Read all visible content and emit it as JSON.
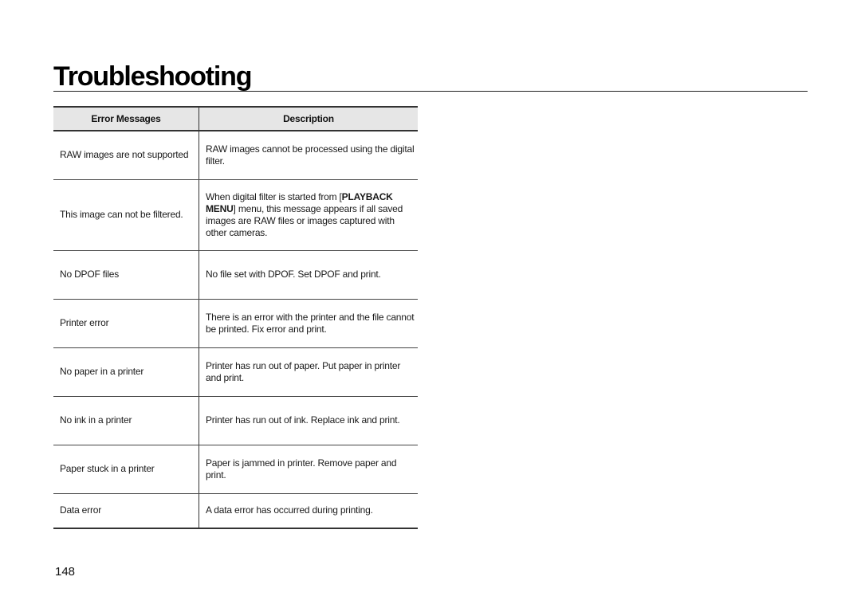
{
  "page": {
    "title": "Troubleshooting",
    "page_number": "148"
  },
  "table": {
    "headers": [
      "Error Messages",
      "Description"
    ],
    "rows": [
      {
        "error": "RAW images are not supported",
        "description": [
          "RAW images cannot be processed using the digital filter."
        ]
      },
      {
        "error": "This image can not be filtered.",
        "description": [
          "When digital filter is started from [",
          "PLAYBACK MENU",
          "] menu, this message appears if all saved images are RAW files or images captured with other cameras."
        ]
      },
      {
        "error": "No DPOF files",
        "description": [
          "No file set with DPOF. Set DPOF and print."
        ]
      },
      {
        "error": "Printer error",
        "description": [
          "There is an error with the printer and the file cannot be printed. Fix error and print."
        ]
      },
      {
        "error": "No paper in a printer",
        "description": [
          "Printer has run out of paper. Put paper in printer and print."
        ]
      },
      {
        "error": "No ink in a printer",
        "description": [
          "Printer has run out of ink. Replace ink and print."
        ]
      },
      {
        "error": "Paper stuck in a printer",
        "description": [
          "Paper is jammed in printer. Remove paper and print."
        ]
      },
      {
        "error": "Data error",
        "description": [
          "A data error has occurred during printing."
        ]
      }
    ]
  }
}
